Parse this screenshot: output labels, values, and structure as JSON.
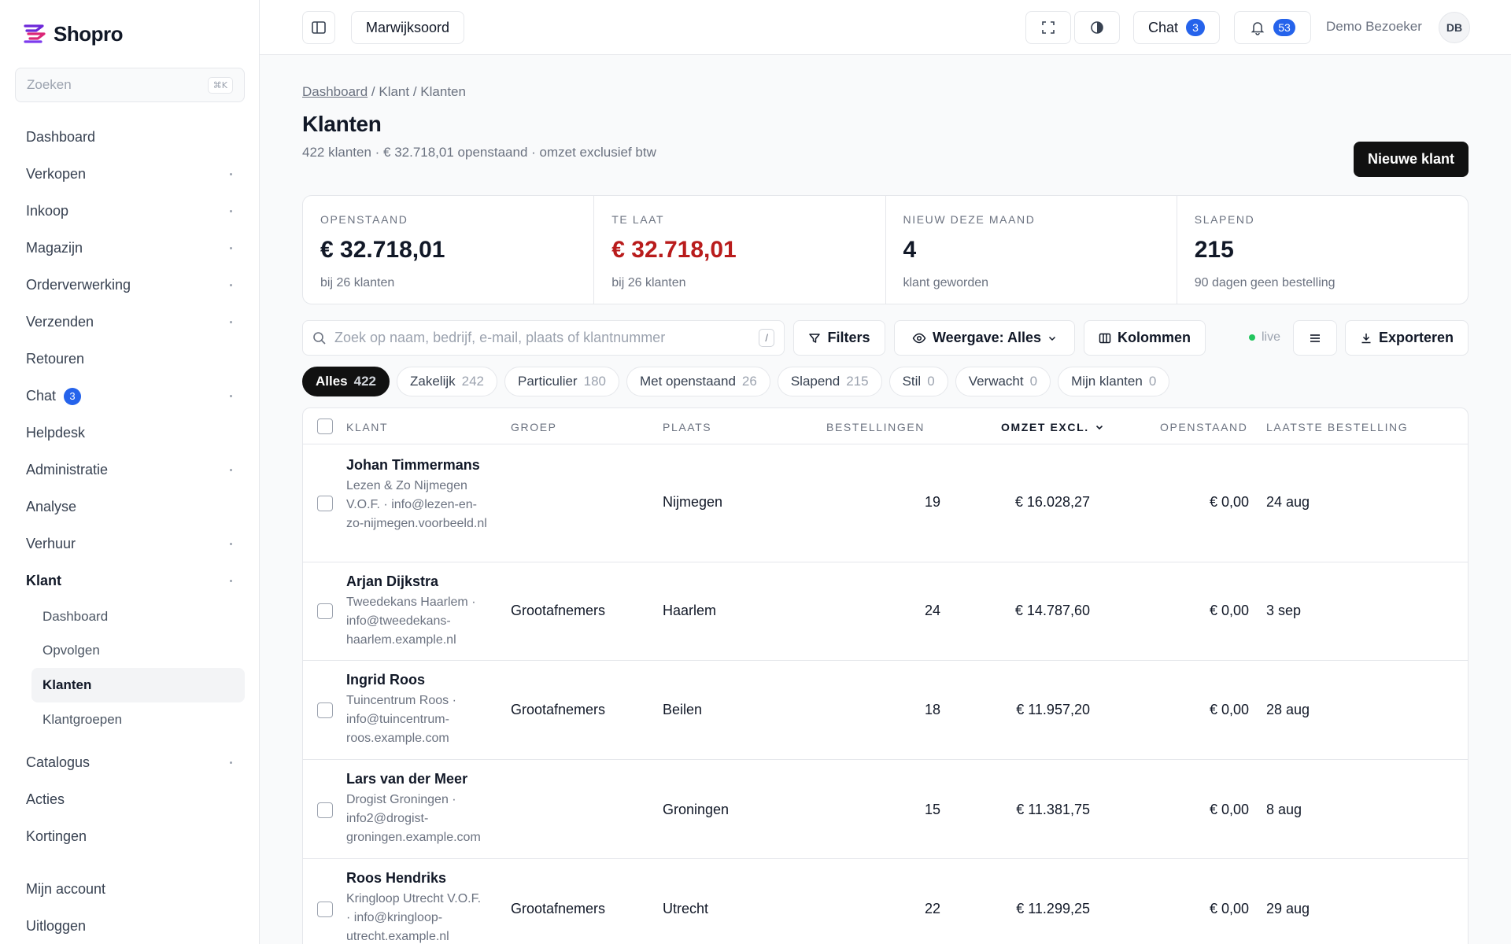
{
  "app": {
    "logo_text": "Shopro",
    "brand_color": "#6d28d9",
    "accent_color": "#2563eb",
    "danger_color": "#b91c1c"
  },
  "sidebar": {
    "search_placeholder": "Zoeken",
    "search_shortcut": "⌘K",
    "items": [
      {
        "label": "Dashboard",
        "has_children": false
      },
      {
        "label": "Verkopen",
        "has_children": true
      },
      {
        "label": "Inkoop",
        "has_children": true
      },
      {
        "label": "Magazijn",
        "has_children": true
      },
      {
        "label": "Orderverwerking",
        "has_children": true
      },
      {
        "label": "Verzenden",
        "has_children": true
      },
      {
        "label": "Retouren",
        "has_children": false
      },
      {
        "label": "Chat",
        "badge": "3",
        "has_children": true
      },
      {
        "label": "Helpdesk",
        "has_children": false
      },
      {
        "label": "Administratie",
        "has_children": true
      },
      {
        "label": "Analyse",
        "has_children": false
      },
      {
        "label": "Verhuur",
        "has_children": true
      },
      {
        "label": "Klant",
        "has_children": true,
        "active": true
      }
    ],
    "klant_sub": [
      "Dashboard",
      "Opvolgen",
      "Klanten",
      "Klantgroepen"
    ],
    "items_after": [
      {
        "label": "Catalogus",
        "has_children": true
      },
      {
        "label": "Acties",
        "has_children": false
      },
      {
        "label": "Kortingen",
        "has_children": false
      }
    ],
    "account": "Mijn account",
    "logout": "Uitloggen"
  },
  "topbar": {
    "location": "Marwijksoord",
    "chat_label": "Chat",
    "chat_badge": "3",
    "notif_badge": "53",
    "user_name": "Demo Bezoeker",
    "user_initials": "DB"
  },
  "page": {
    "breadcrumb": [
      "Dashboard",
      "Klant",
      "Klanten"
    ],
    "title": "Klanten",
    "subtitle": "422 klanten · € 32.718,01 openstaand · omzet exclusief btw",
    "new_button": "Nieuwe klant"
  },
  "stats": [
    {
      "label": "OPENSTAAND",
      "value": "€ 32.718,01",
      "note": "bij 26 klanten",
      "danger": false
    },
    {
      "label": "TE LAAT",
      "value": "€ 32.718,01",
      "note": "bij 26 klanten",
      "danger": true
    },
    {
      "label": "NIEUW DEZE MAAND",
      "value": "4",
      "note": "klant geworden",
      "danger": false
    },
    {
      "label": "SLAPEND",
      "value": "215",
      "note": "90 dagen geen bestelling",
      "danger": false
    }
  ],
  "toolbar": {
    "search_placeholder": "Zoek op naam, bedrijf, e-mail, plaats of klantnummer",
    "search_shortcut": "/",
    "filters": "Filters",
    "view": "Weergave: Alles",
    "columns": "Kolommen",
    "live": "live",
    "export": "Exporteren"
  },
  "chips": [
    {
      "label": "Alles",
      "count": "422",
      "active": true
    },
    {
      "label": "Zakelijk",
      "count": "242"
    },
    {
      "label": "Particulier",
      "count": "180"
    },
    {
      "label": "Met openstaand",
      "count": "26"
    },
    {
      "label": "Slapend",
      "count": "215"
    },
    {
      "label": "Stil",
      "count": "0"
    },
    {
      "label": "Verwacht",
      "count": "0"
    },
    {
      "label": "Mijn klanten",
      "count": "0"
    }
  ],
  "table": {
    "headers": {
      "klant": "KLANT",
      "groep": "GROEP",
      "plaats": "PLAATS",
      "bestellingen": "BESTELLINGEN",
      "omzet": "OMZET EXCL.",
      "openstaand": "OPENSTAAND",
      "laatste": "LAATSTE BESTELLING"
    },
    "rows": [
      {
        "name": "Johan Timmermans",
        "meta": "Lezen & Zo Nijmegen V.O.F. · info@lezen-en-zo-nijmegen.voorbeeld.nl",
        "groep": "",
        "plaats": "Nijmegen",
        "bestellingen": "19",
        "omzet": "€ 16.028,27",
        "openstaand": "€ 0,00",
        "laatste": "24 aug"
      },
      {
        "name": "Arjan Dijkstra",
        "meta": "Tweedekans Haarlem · info@tweedekans-haarlem.example.nl",
        "groep": "Grootafnemers",
        "plaats": "Haarlem",
        "bestellingen": "24",
        "omzet": "€ 14.787,60",
        "openstaand": "€ 0,00",
        "laatste": "3 sep"
      },
      {
        "name": "Ingrid Roos",
        "meta": "Tuincentrum Roos · info@tuincentrum-roos.example.com",
        "groep": "Grootafnemers",
        "plaats": "Beilen",
        "bestellingen": "18",
        "omzet": "€ 11.957,20",
        "openstaand": "€ 0,00",
        "laatste": "28 aug"
      },
      {
        "name": "Lars van der Meer",
        "meta": "Drogist Groningen · info2@drogist-groningen.example.com",
        "groep": "",
        "plaats": "Groningen",
        "bestellingen": "15",
        "omzet": "€ 11.381,75",
        "openstaand": "€ 0,00",
        "laatste": "8 aug"
      },
      {
        "name": "Roos Hendriks",
        "meta": "Kringloop Utrecht V.O.F. · info@kringloop-utrecht.example.nl",
        "groep": "Grootafnemers",
        "plaats": "Utrecht",
        "bestellingen": "22",
        "omzet": "€ 11.299,25",
        "openstaand": "€ 0,00",
        "laatste": "29 aug"
      }
    ]
  }
}
